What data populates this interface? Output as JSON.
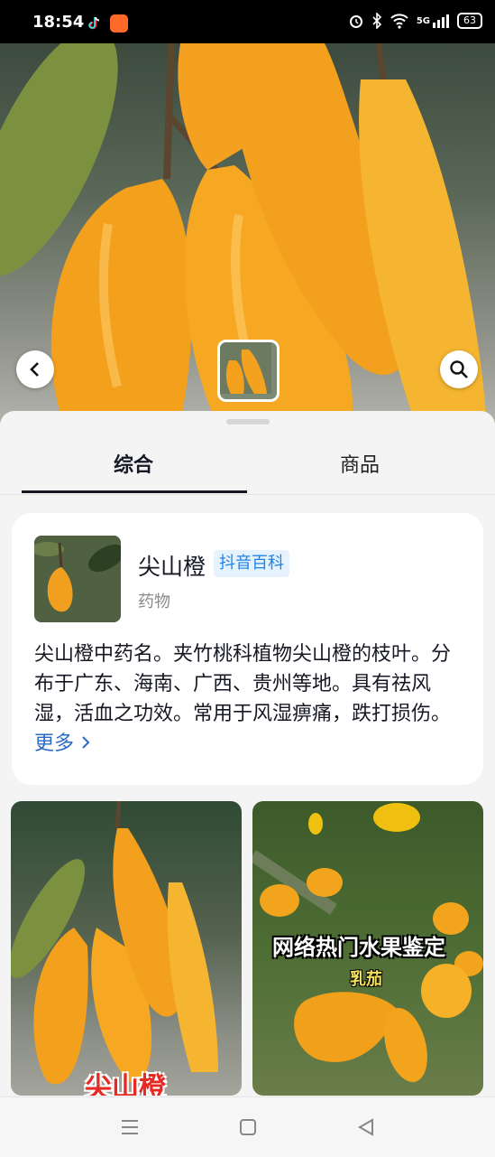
{
  "status_bar": {
    "time": "18:54",
    "network": "5G",
    "battery": "63"
  },
  "hero": {
    "back_icon": "chevron-left-icon",
    "search_icon": "search-icon"
  },
  "tabs": [
    {
      "label": "综合",
      "active": true
    },
    {
      "label": "商品",
      "active": false
    }
  ],
  "entry": {
    "title": "尖山橙",
    "badge": "抖音百科",
    "category": "药物",
    "description": "尖山橙中药名。夹竹桃科植物尖山橙的枝叶。分布于广东、海南、广西、贵州等地。具有祛风湿，活血之功效。常用于风湿痹痛，跌打损伤。",
    "more_label": "更多"
  },
  "results": [
    {
      "overlay": "尖山橙"
    },
    {
      "overlay": "网络热门水果鉴定",
      "overlay_sub": "乳茄"
    }
  ],
  "colors": {
    "accent_blue": "#1d84e6",
    "fruit_orange": "#f2a21f",
    "text_dark": "#161823"
  }
}
